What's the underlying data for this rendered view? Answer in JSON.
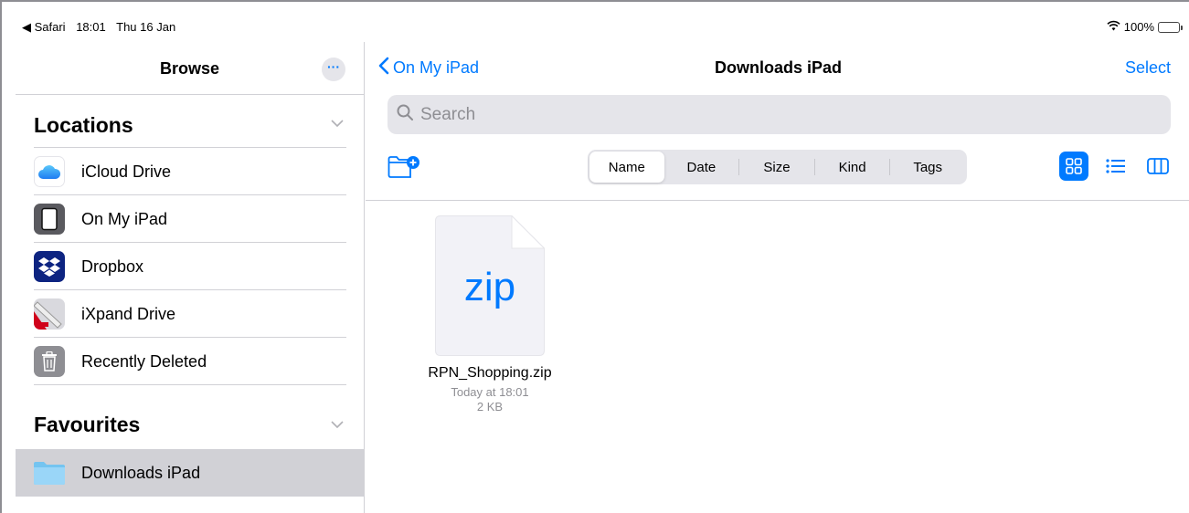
{
  "status": {
    "back_app": "◀ Safari",
    "time": "18:01",
    "date": "Thu 16 Jan",
    "battery": "100%"
  },
  "sidebar": {
    "title": "Browse",
    "more_label": "···",
    "locations": {
      "title": "Locations",
      "items": [
        {
          "label": "iCloud Drive",
          "icon": "icloud-icon"
        },
        {
          "label": "On My iPad",
          "icon": "ipad-icon"
        },
        {
          "label": "Dropbox",
          "icon": "dropbox-icon"
        },
        {
          "label": "iXpand Drive",
          "icon": "ixpand-icon"
        },
        {
          "label": "Recently Deleted",
          "icon": "trash-icon"
        }
      ]
    },
    "favourites": {
      "title": "Favourites",
      "items": [
        {
          "label": "Downloads iPad",
          "icon": "folder-icon",
          "selected": true
        }
      ]
    }
  },
  "main": {
    "back_label": "On My iPad",
    "title": "Downloads iPad",
    "select_label": "Select",
    "search_placeholder": "Search",
    "sort_tabs": [
      {
        "label": "Name",
        "active": true
      },
      {
        "label": "Date"
      },
      {
        "label": "Size"
      },
      {
        "label": "Kind"
      },
      {
        "label": "Tags"
      }
    ],
    "view_modes": [
      "grid-view-icon",
      "list-view-icon",
      "column-view-icon"
    ],
    "active_view": "grid-view-icon",
    "files": [
      {
        "ext": "zip",
        "name": "RPN_Shopping.zip",
        "date": "Today at 18:01",
        "size": "2 KB"
      }
    ]
  },
  "colors": {
    "accent": "#007aff",
    "selected_row": "#d1d1d6",
    "separator": "#d1d1d6"
  }
}
